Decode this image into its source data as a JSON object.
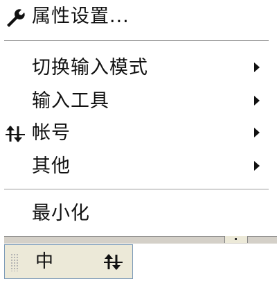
{
  "menu": {
    "properties": {
      "label": "属性设置...",
      "icon": "wrench-icon"
    },
    "switch_input_mode": {
      "label": "切换输入模式",
      "has_submenu": true
    },
    "input_tools": {
      "label": "输入工具",
      "has_submenu": true
    },
    "account": {
      "label": "帐号",
      "icon": "account-switch-icon",
      "has_submenu": true
    },
    "other": {
      "label": "其他",
      "has_submenu": true
    },
    "minimize": {
      "label": "最小化"
    }
  },
  "ime_bar": {
    "mode_label": "中",
    "punctuation_icon": "half-width-moon-icon",
    "tools_icon": "account-switch-icon"
  },
  "colors": {
    "menu_bg": "#ffffff",
    "separator": "#9a9a9a",
    "bar_bg": "#ece9d8",
    "bar_border": "#7f9db9"
  }
}
